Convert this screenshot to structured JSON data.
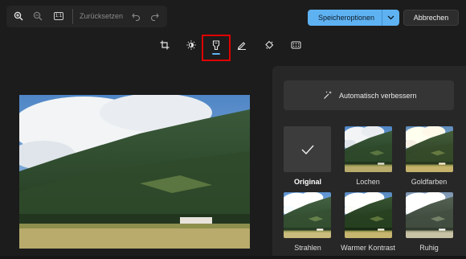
{
  "toolbar": {
    "reset_label": "Zurücksetzen",
    "zoom_in_icon": "zoom-in-icon",
    "zoom_out_icon": "zoom-out-icon",
    "actual_size_label": "1:1",
    "undo_icon": "undo-icon",
    "redo_icon": "redo-icon"
  },
  "actions": {
    "save_label": "Speicheroptionen",
    "cancel_label": "Abbrechen"
  },
  "tools": [
    {
      "name": "crop-icon",
      "selected": false
    },
    {
      "name": "adjust-brightness-icon",
      "selected": false
    },
    {
      "name": "filter-icon",
      "selected": true
    },
    {
      "name": "markup-pen-icon",
      "selected": false
    },
    {
      "name": "erase-icon",
      "selected": false
    },
    {
      "name": "background-blur-icon",
      "selected": false
    }
  ],
  "panel": {
    "auto_enhance_label": "Automatisch verbessern",
    "filters": [
      {
        "label": "Original",
        "selected": true
      },
      {
        "label": "Lochen",
        "selected": false
      },
      {
        "label": "Goldfarben",
        "selected": false
      },
      {
        "label": "Strahlen",
        "selected": false
      },
      {
        "label": "Warmer Kontrast",
        "selected": false
      },
      {
        "label": "Ruhig",
        "selected": false
      }
    ]
  },
  "colors": {
    "accent": "#5fb2f2",
    "highlight": "#e00000",
    "background": "#1c1c1c",
    "panel": "#272727"
  }
}
